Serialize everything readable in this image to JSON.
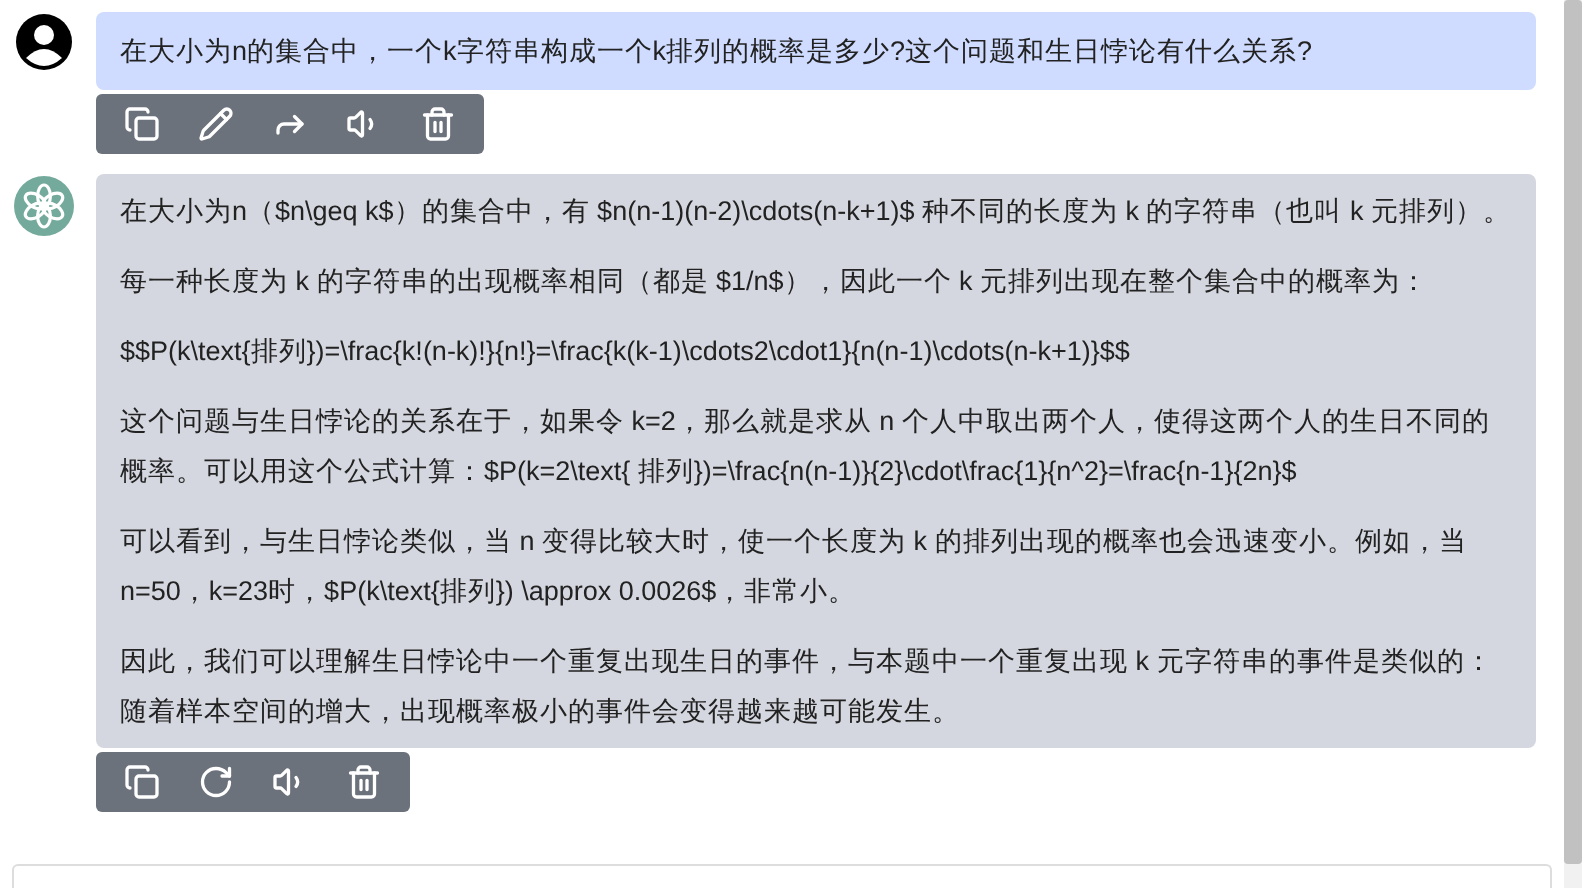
{
  "messages": [
    {
      "kind": "user",
      "paragraphs": [
        "在大小为n的集合中，一个k字符串构成一个k排列的概率是多少?这个问题和生日悖论有什么关系?"
      ],
      "actions": [
        {
          "kind": "copy"
        },
        {
          "kind": "edit"
        },
        {
          "kind": "share"
        },
        {
          "kind": "speak"
        },
        {
          "kind": "delete"
        }
      ]
    },
    {
      "kind": "assistant",
      "paragraphs": [
        "在大小为n（$n\\geq k$）的集合中，有 $n(n-1)(n-2)\\cdots(n-k+1)$ 种不同的长度为 k 的字符串（也叫 k 元排列）。",
        "每一种长度为 k 的字符串的出现概率相同（都是 $1/n$），因此一个 k 元排列出现在整个集合中的概率为：",
        "$$P(k\\text{排列})=\\frac{k!(n-k)!}{n!}=\\frac{k(k-1)\\cdots2\\cdot1}{n(n-1)\\cdots(n-k+1)}$$",
        "这个问题与生日悖论的关系在于，如果令 k=2，那么就是求从 n 个人中取出两个人，使得这两个人的生日不同的概率。可以用这个公式计算：$P(k=2\\text{ 排列})=\\frac{n(n-1)}{2}\\cdot\\frac{1}{n^2}=\\frac{n-1}{2n}$",
        "可以看到，与生日悖论类似，当 n 变得比较大时，使一个长度为 k 的排列出现的概率也会迅速变小。例如，当 n=50，k=23时，$P(k\\text{排列}) \\approx 0.0026$，非常小。",
        "因此，我们可以理解生日悖论中一个重复出现生日的事件，与本题中一个重复出现 k 元字符串的事件是类似的：随着样本空间的增大，出现概率极小的事件会变得越来越可能发生。"
      ],
      "actions": [
        {
          "kind": "copy"
        },
        {
          "kind": "regenerate"
        },
        {
          "kind": "speak"
        },
        {
          "kind": "delete"
        }
      ]
    }
  ]
}
